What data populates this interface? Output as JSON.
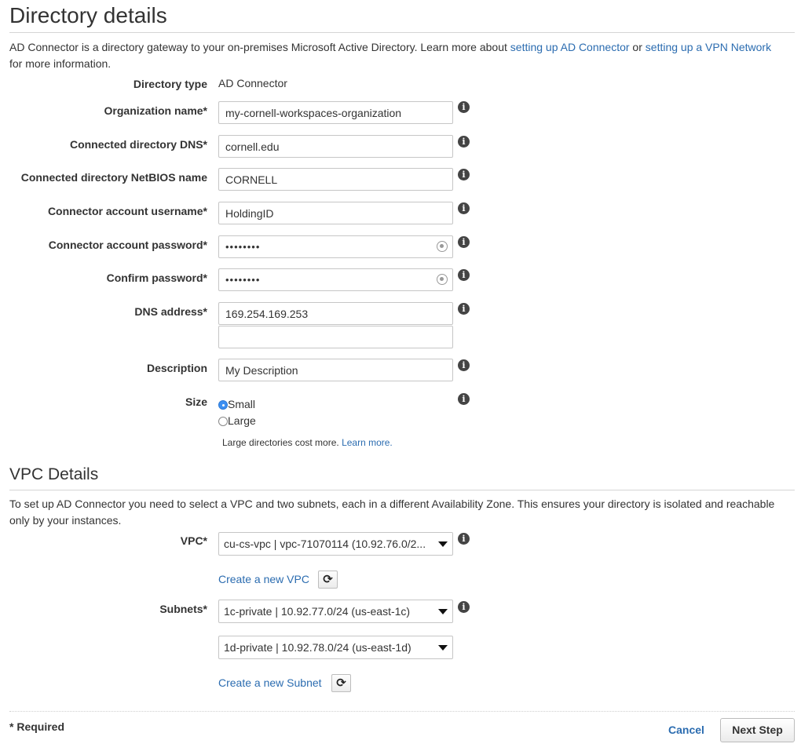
{
  "directory_details": {
    "title": "Directory details",
    "intro_text": "AD Connector is a directory gateway to your on-premises Microsoft Active Directory. Learn more about ",
    "link_ad": "setting up AD Connector",
    "or_text": " or ",
    "link_vpn": "setting up a VPN Network",
    "intro_tail": "for more information.",
    "directory_type_label": "Directory type",
    "directory_type_value": "AD Connector",
    "org_name_label": "Organization name*",
    "org_name_value": "my-cornell-workspaces-organization",
    "dns_label": "Connected directory DNS*",
    "dns_value": "cornell.edu",
    "netbios_label": "Connected directory NetBIOS name",
    "netbios_value": "CORNELL",
    "username_label": "Connector account username*",
    "username_value": "HoldingID",
    "password_label": "Connector account password*",
    "password_value": "••••••••",
    "confirm_label": "Confirm password*",
    "confirm_value": "••••••••",
    "dns_address_label": "DNS address*",
    "dns_address_value": "169.254.169.253",
    "dns_address2_value": "",
    "description_label": "Description",
    "description_value": "My Description",
    "size_label": "Size",
    "size_small": "Small",
    "size_large": "Large",
    "size_note": "Large directories cost more. ",
    "size_note_link": "Learn more."
  },
  "vpc_details": {
    "title": "VPC Details",
    "intro_text": "To set up AD Connector you need to select a VPC and two subnets, each in a different Availability Zone. This ensures your directory is isolated and reachable only by your instances.",
    "vpc_label": "VPC*",
    "vpc_value": "cu-cs-vpc | vpc-71070114 (10.92.76.0/2...",
    "create_vpc": "Create a new VPC",
    "subnets_label": "Subnets*",
    "subnet1_value": "1c-private | 10.92.77.0/24 (us-east-1c)",
    "subnet2_value": "1d-private | 10.92.78.0/24 (us-east-1d)",
    "create_subnet": "Create a new Subnet"
  },
  "footer": {
    "required": "* Required",
    "cancel": "Cancel",
    "next": "Next Step"
  },
  "icons": {
    "info": "info-icon",
    "refresh": "refresh-icon",
    "dropdown": "chevron-down-icon"
  }
}
